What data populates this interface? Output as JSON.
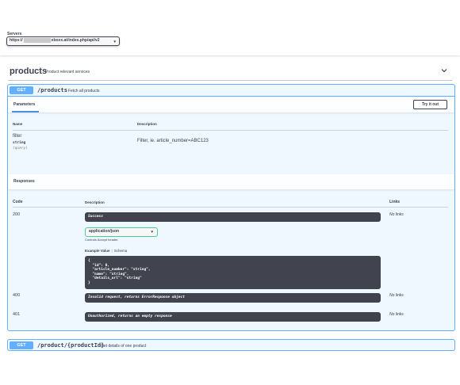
{
  "servers": {
    "label": "Servers",
    "url_prefix": "https://",
    "url_suffix": "eboxx.at/index.php/api/v2"
  },
  "tag": {
    "name": "products",
    "description": "Product relevant services"
  },
  "operations": [
    {
      "method": "GET",
      "path": "/products",
      "summary": "Fetch all products",
      "parameters_title": "Parameters",
      "try_it_out_label": "Try it out",
      "param_headers": {
        "name": "Name",
        "description": "Description"
      },
      "params": [
        {
          "name": "filter",
          "type": "string",
          "in": "(query)",
          "description": "Filter, ie. article_number=ABC123"
        }
      ],
      "responses_title": "Responses",
      "response_headers": {
        "code": "Code",
        "description": "Description",
        "links": "Links"
      },
      "responses": [
        {
          "code": "200",
          "description": "Success",
          "links": "No links"
        },
        {
          "code": "400",
          "description": "Invalid request, returns ErrorResponse object",
          "links": "No links"
        },
        {
          "code": "401",
          "description": "Unauthorized, returns an empty response",
          "links": "No links"
        }
      ],
      "media_type": "application/json",
      "media_note": "Controls Accept header.",
      "example_tabs": {
        "value": "Example Value",
        "schema": "Schema"
      },
      "example_code": "{\n  \"id\": 0,\n  \"article_number\": \"string\",\n  \"name\": \"string\",\n  \"details_url\": \"string\"\n}"
    },
    {
      "method": "GET",
      "path": "/product/{productId}",
      "summary": "Get details of one product"
    }
  ],
  "colors": {
    "get_accent": "#61affe",
    "dark_block": "#41444e",
    "media_border": "#49cc90"
  },
  "icons": [
    "chevron-down-icon",
    "select-caret-icon"
  ]
}
